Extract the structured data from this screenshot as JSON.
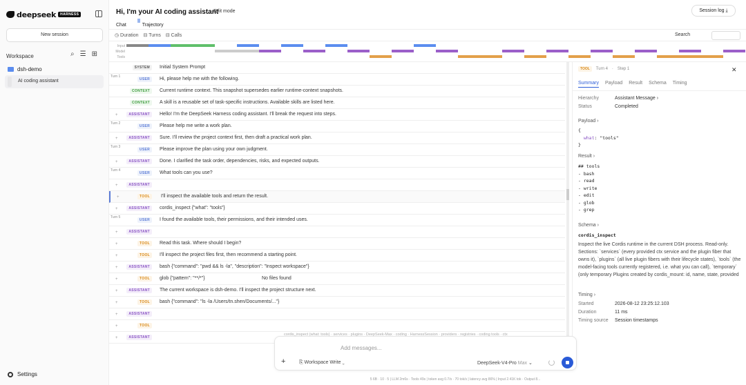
{
  "sidebar": {
    "logo_text": "deepseek",
    "logo_badge": "HARNESS",
    "new_session": "New session",
    "workspace_label": "Workspace",
    "folder_name": "dsh-demo",
    "session_item": "AI coding assistant",
    "settings": "Settings"
  },
  "header": {
    "title": "Hi, I'm your AI coding assistant",
    "edit_mode": "Edit mode",
    "session_log": "Session log ⤓",
    "tabs": [
      "Chat",
      "Trajectory"
    ]
  },
  "toolbar": {
    "duration": "◷ Duration",
    "turns": "⊟ Turns",
    "calls": "⊟ Calls",
    "search": "Search"
  },
  "timeline_labels": [
    "Input",
    "Model",
    "Tools"
  ],
  "rows": [
    {
      "turn": "",
      "role": "SYSTEM",
      "kind": "system",
      "text": "Initial System Prompt"
    },
    {
      "turn": "Turn 1",
      "role": "USER",
      "kind": "user",
      "text": "Hi, please help me with the following."
    },
    {
      "turn": "",
      "role": "CONTEXT",
      "kind": "context",
      "text": "Current runtime context. This snapshot supersedes earlier runtime-context snapshots."
    },
    {
      "turn": "",
      "role": "CONTEXT",
      "kind": "context",
      "text": "A skill is a reusable set of task-specific instructions. Available skills are listed here."
    },
    {
      "turn": "",
      "role": "ASSISTANT",
      "kind": "assistant",
      "text": "Hello! I'm the DeepSeek Harness coding assistant. I'll break the request into steps."
    },
    {
      "turn": "Turn 2",
      "role": "USER",
      "kind": "user",
      "text": "Please help me write a work plan."
    },
    {
      "turn": "",
      "role": "ASSISTANT",
      "kind": "assistant",
      "text": "Sure. I'll review the project context first, then draft a practical work plan."
    },
    {
      "turn": "Turn 3",
      "role": "USER",
      "kind": "user",
      "text": "Please improve the plan using your own judgment."
    },
    {
      "turn": "",
      "role": "ASSISTANT",
      "kind": "assistant",
      "text": "Done. I clarified the task order, dependencies, risks, and expected outputs."
    },
    {
      "turn": "Turn 4",
      "role": "USER",
      "kind": "user",
      "text": "What tools can you use?"
    },
    {
      "turn": "",
      "role": "ASSISTANT",
      "kind": "assistant",
      "text": ""
    },
    {
      "turn": "",
      "role": "TOOL",
      "kind": "tool",
      "text": "I'll inspect the available tools and return the result.",
      "selected": true
    },
    {
      "turn": "",
      "role": "ASSISTANT",
      "kind": "assistant",
      "text": "cordis_inspect  {\"what\": \"tools\"}"
    },
    {
      "turn": "Turn 5",
      "role": "USER",
      "kind": "user",
      "text": "I found the available tools, their permissions, and their intended uses."
    },
    {
      "turn": "",
      "role": "ASSISTANT",
      "kind": "assistant",
      "text": ""
    },
    {
      "turn": "",
      "role": "TOOL",
      "kind": "tool",
      "text": "Read this task. Where should I begin?"
    },
    {
      "turn": "",
      "role": "TOOL",
      "kind": "tool",
      "text": "I'll inspect the project files first, then recommend a starting point."
    },
    {
      "turn": "",
      "role": "ASSISTANT",
      "kind": "assistant",
      "text": "bash  {\"command\": \"pwd && ls -la\", \"description\": \"Inspect workspace\"}"
    },
    {
      "turn": "",
      "role": "TOOL",
      "kind": "tool",
      "text": "glob  {\"pattern\": \"**/*\"}",
      "text2": "No files found"
    },
    {
      "turn": "",
      "role": "ASSISTANT",
      "kind": "assistant",
      "text": "The current workspace is dsh-demo. I'll inspect the project structure next."
    },
    {
      "turn": "",
      "role": "TOOL",
      "kind": "tool",
      "text": "bash  {\"command\": \"ls -la /Users/tn.shen/Documents/...\"}"
    },
    {
      "turn": "",
      "role": "ASSISTANT",
      "kind": "assistant",
      "text": ""
    },
    {
      "turn": "",
      "role": "TOOL",
      "kind": "tool",
      "text": ""
    },
    {
      "turn": "",
      "role": "ASSISTANT",
      "kind": "assistant",
      "text": ""
    }
  ],
  "detail": {
    "tag": "TOOL",
    "turn": "Turn 4",
    "step": "Step 1",
    "tabs": [
      "Summary",
      "Payload",
      "Result",
      "Schema",
      "Timing"
    ],
    "hierarchy_label": "Hierarchy",
    "hierarchy_value": "Assistant Message ›",
    "status_label": "Status",
    "status_value": "Completed",
    "payload_label": "Payload ›",
    "payload_open": "{",
    "payload_key": "what",
    "payload_val": "\"tools\"",
    "payload_close": "}",
    "result_label": "Result ›",
    "result_text": "## tools\n- bash\n- read\n- write\n- edit\n- glob\n- grep",
    "schema_label": "Schema ›",
    "schema_name": "cordis_inspect",
    "schema_desc": "Inspect the live Cordis runtime in the current DSH process. Read-only. Sections: `services` (every provided ctx service and the plugin fiber that owns it), `plugins` (all live plugin fibers with their lifecycle states), `tools` (the model-facing tools currently registered, i.e. what you can call), `temporary` (only temporary Plugins created by cordis_mount: id, name, state, provided",
    "timing_label": "Timing ›",
    "started_label": "Started",
    "started_value": "2026-08-12 23:25:12.103",
    "duration_label": "Duration",
    "duration_value": "11 ms",
    "source_label": "Timing source",
    "source_value": "Session timestamps"
  },
  "composer": {
    "placeholder": "Add messages...",
    "mode": "Workspace Write",
    "model": "DeepSeek-V4-Pro",
    "model_suffix": "Max"
  },
  "behind_text": "cordis_inspect (what: tools)  ·  services  ·  plugins  ·  DeepSeek-Max  ·  coding  ·  HarnessSession  ·  providers  ·  registries  ·  coding tools  ·  ctx",
  "statusbar": "5 6B · 10 · 5   |   LLM 2m6s · Tools 49s   |   token avg 0.7/s · 70 tok/s   |   latency avg 86%   |   Input 2.41K tok · Output 8...",
  "colors": {
    "user": "#5b7bd6",
    "assistant": "#8a55c4",
    "tool": "#d88918",
    "context": "#3a9a3a",
    "accent": "#2a5bd7"
  }
}
